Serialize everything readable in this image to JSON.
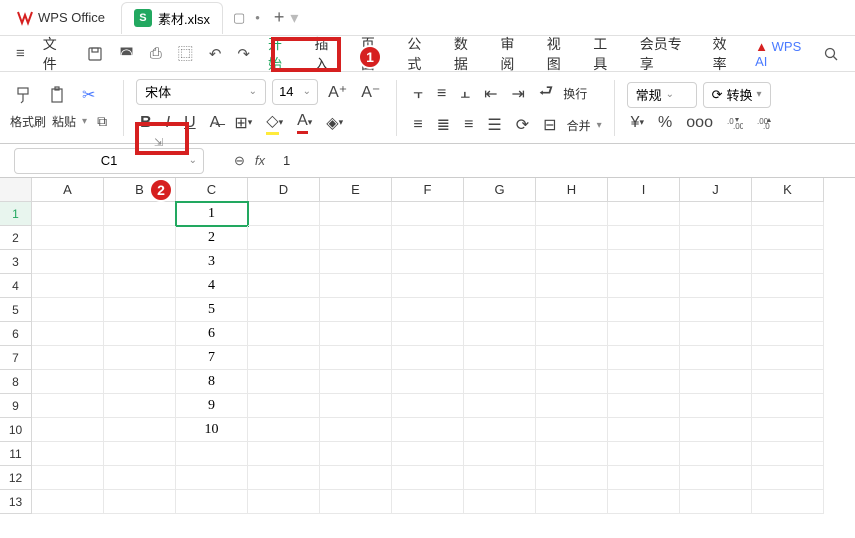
{
  "app": {
    "name": "WPS Office"
  },
  "tab": {
    "icon_letter": "S",
    "filename": "素材.xlsx"
  },
  "menubar": {
    "file": "文件",
    "items": [
      "开始",
      "插入",
      "页面",
      "公式",
      "数据",
      "审阅",
      "视图",
      "工具",
      "会员专享",
      "效率"
    ],
    "active_index": 0,
    "ai": "WPS AI"
  },
  "ribbon": {
    "format_painter": "格式刷",
    "paste": "粘贴",
    "font_name": "宋体",
    "font_size": "14",
    "wrap": "换行",
    "merge": "合并",
    "general": "常规",
    "rotate": "转换"
  },
  "formula": {
    "cell_ref": "C1",
    "fx": "fx",
    "value": "1"
  },
  "grid": {
    "cols": [
      "A",
      "B",
      "C",
      "D",
      "E",
      "F",
      "G",
      "H",
      "I",
      "J",
      "K"
    ],
    "rows": 13,
    "active_cell": "C1",
    "cells": {
      "C1": "1",
      "C2": "2",
      "C3": "3",
      "C4": "4",
      "C5": "5",
      "C6": "6",
      "C7": "7",
      "C8": "8",
      "C9": "9",
      "C10": "10"
    }
  },
  "markers": {
    "m1": "1",
    "m2": "2"
  },
  "chart_data": null
}
